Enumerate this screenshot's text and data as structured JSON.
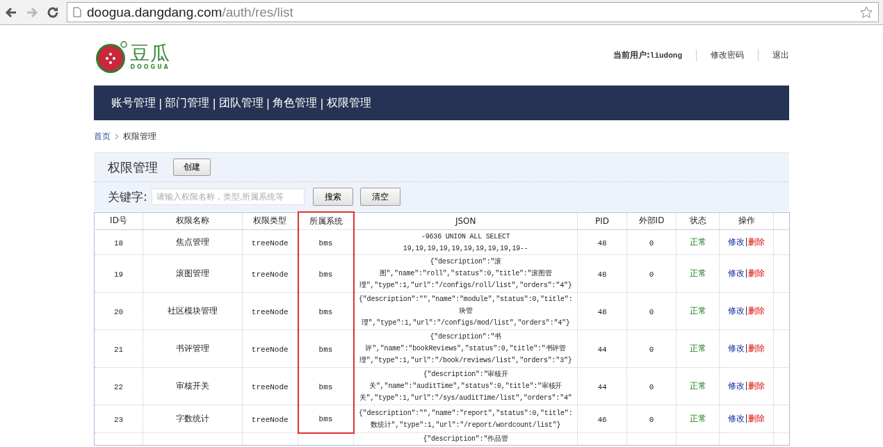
{
  "browser": {
    "back_disabled": false,
    "forward_disabled": true,
    "url_host": "doogua.dangdang.com",
    "url_path": "/auth/res/list"
  },
  "logo": {
    "name": "豆瓜",
    "subtitle": "DOOGUA"
  },
  "user": {
    "label": "当前用户:",
    "name": "liudong",
    "links": [
      "修改密码",
      "退出"
    ]
  },
  "nav": {
    "separator": "|",
    "items": [
      "账号管理",
      "部门管理",
      "团队管理",
      "角色管理",
      "权限管理"
    ]
  },
  "breadcrumb": {
    "home": "首页",
    "current": "权限管理"
  },
  "panel": {
    "title": "权限管理",
    "create_button": "创建",
    "search_label": "关键字:",
    "search_placeholder": "请输入权限名称，类型,所属系统等",
    "search_button": "搜索",
    "clear_button": "清空"
  },
  "table": {
    "columns": [
      {
        "label": "ID号",
        "highlighted": false
      },
      {
        "label": "权限名称",
        "highlighted": false
      },
      {
        "label": "权限类型",
        "highlighted": false
      },
      {
        "label": "所属系统",
        "highlighted": true
      },
      {
        "label": "JSON",
        "highlighted": false
      },
      {
        "label": "PID",
        "highlighted": false
      },
      {
        "label": "外部ID",
        "highlighted": false
      },
      {
        "label": "状态",
        "highlighted": false
      },
      {
        "label": "操作",
        "highlighted": false
      }
    ],
    "rows": [
      {
        "kind": "full",
        "id": "18",
        "name": "焦点管理",
        "type": "treeNode",
        "system": "bms",
        "json": [
          "-9636 UNION ALL SELECT",
          "19,19,19,19,19,19,19,19,19,19--"
        ],
        "pid": "48",
        "external_id": "0",
        "status": "正常",
        "edit": "修改",
        "sep": "|",
        "delete": "删除"
      },
      {
        "kind": "full",
        "id": "19",
        "name": "滚图管理",
        "type": "treeNode",
        "system": "bms",
        "json": [
          "{\"description\":\"滚",
          "图\",\"name\":\"roll\",\"status\":0,\"title\":\"滚图管",
          "理\",\"type\":1,\"url\":\"/configs/roll/list\",\"orders\":\"4\"}"
        ],
        "pid": "48",
        "external_id": "0",
        "status": "正常",
        "edit": "修改",
        "sep": "|",
        "delete": "删除"
      },
      {
        "kind": "full",
        "id": "20",
        "name": "社区模块管理",
        "type": "treeNode",
        "system": "bms",
        "json": [
          "{\"description\":\"\",\"name\":\"module\",\"status\":0,\"title\":",
          "块管",
          "理\",\"type\":1,\"url\":\"/configs/mod/list\",\"orders\":\"4\"}"
        ],
        "pid": "48",
        "external_id": "0",
        "status": "正常",
        "edit": "修改",
        "sep": "|",
        "delete": "删除"
      },
      {
        "kind": "full",
        "id": "21",
        "name": "书评管理",
        "type": "treeNode",
        "system": "bms",
        "json": [
          "{\"description\":\"书",
          "评\",\"name\":\"bookReviews\",\"status\":0,\"title\":\"书评管",
          "理\",\"type\":1,\"url\":\"/book/reviews/list\",\"orders\":\"3\"}"
        ],
        "pid": "44",
        "external_id": "0",
        "status": "正常",
        "edit": "修改",
        "sep": "|",
        "delete": "删除"
      },
      {
        "kind": "full",
        "id": "22",
        "name": "审核开关",
        "type": "treeNode",
        "system": "bms",
        "json": [
          "{\"description\":\"审核开",
          "关\",\"name\":\"auditTime\",\"status\":0,\"title\":\"审核开",
          "关\",\"type\":1,\"url\":\"/sys/auditTime/list\",\"orders\":\"4\""
        ],
        "pid": "44",
        "external_id": "0",
        "status": "正常",
        "edit": "修改",
        "sep": "|",
        "delete": "删除"
      },
      {
        "kind": "full",
        "id": "23",
        "name": "字数统计",
        "type": "treeNode",
        "system": "bms",
        "json": [
          "{\"description\":\"\",\"name\":\"report\",\"status\":0,\"title\":",
          "数统计\",\"type\":1,\"url\":\"/report/wordcount/list\"}"
        ],
        "pid": "46",
        "external_id": "0",
        "status": "正常",
        "edit": "修改",
        "sep": "|",
        "delete": "删除"
      },
      {
        "kind": "partial",
        "json": [
          "{\"description\":\"作品管"
        ]
      }
    ]
  }
}
